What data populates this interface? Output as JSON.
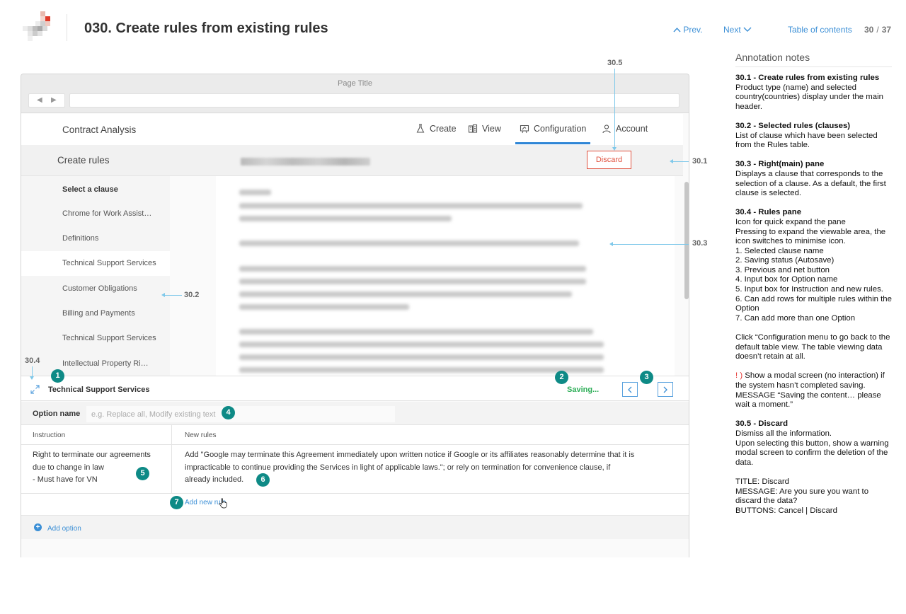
{
  "header": {
    "doc_title": "030. Create rules from existing rules",
    "prev_label": "Prev.",
    "next_label": "Next",
    "toc_label": "Table of contents",
    "page_current": "30",
    "page_sep": "/",
    "page_total": "37"
  },
  "mock": {
    "window_title": "Page Title",
    "app_name": "Contract Analysis",
    "menu": [
      {
        "label": "Create",
        "icon": "flask-icon"
      },
      {
        "label": "View",
        "icon": "building-icon"
      },
      {
        "label": "Configuration",
        "icon": "config-icon",
        "active": true
      },
      {
        "label": "Account",
        "icon": "user-icon"
      }
    ],
    "sub_title": "Create rules",
    "discard_label": "Discard",
    "sidebar": {
      "heading": "Select a clause",
      "items": [
        "Chrome for Work Assist…",
        "Definitions",
        "Technical Support Services",
        "Customer Obligations",
        "Billing and Payments",
        "Technical Support Services",
        "Intellectual Property Ri…"
      ],
      "selected_index": 2
    },
    "rules_pane": {
      "clause_name": "Technical Support Services",
      "saving_status": "Saving...",
      "option_label": "Option name",
      "option_placeholder": "e.g. Replace all, Modify existing text",
      "col_instruction": "Instruction",
      "col_new_rules": "New rules",
      "instruction_lines": [
        "Right to terminate our agreements",
        "due to change in law",
        "- Must have for VN"
      ],
      "new_rule_text": "Add \"Google may terminate this Agreement immediately upon written notice if Google or its affiliates reasonably determine that it is impracticable to continue providing the Services in light of applicable laws.\"; or rely on termination for convenience clause, if already included.",
      "add_new_rule": "Add new rule",
      "add_option": "Add option"
    }
  },
  "callouts": {
    "c30_1": "30.1",
    "c30_2": "30.2",
    "c30_3": "30.3",
    "c30_4": "30.4",
    "c30_5": "30.5",
    "badges": [
      "1",
      "2",
      "3",
      "4",
      "5",
      "6",
      "7"
    ]
  },
  "annotations": {
    "title": "Annotation notes",
    "s1_title": "30.1 - Create rules from existing rules",
    "s1_body": "Product type (name) and selected country(countries) display under the main header.",
    "s2_title": "30.2 - Selected rules (clauses)",
    "s2_body": "List of clause which have been selected from the Rules table.",
    "s3_title": "30.3 - Right(main) pane",
    "s3_body": "Displays a clause that corresponds to the selection of a clause. As a default, the first clause is selected.",
    "s4_title": "30.4 - Rules pane",
    "s4_body1": "Icon for quick expand the pane",
    "s4_body2": "Pressing to expand the viewable area, the icon switches to minimise icon.",
    "s4_list": [
      "1.    Selected clause name",
      "2.    Saving status (Autosave)",
      "3.    Previous and net button",
      "4.    Input box for Option name",
      "5.    Input box for Instruction and new rules.",
      "6.    Can add rows for multiple rules within the Option",
      "7.    Can add more than one Option"
    ],
    "s4_note": "Click “Configuration menu to go back to the default table view.  The table viewing data doesn’t retain at all.",
    "warn_mark": "! )",
    "warn_body": " Show a modal screen (no interaction) if the system hasn’t completed saving.",
    "warn_msg": "MESSAGE “Saving the content… please wait a moment.”",
    "s5_title": "30.5 - Discard",
    "s5_body1": "Dismiss all the information.",
    "s5_body2": "Upon selecting this button, show a warning modal screen to confirm the deletion of the data.",
    "s5_t": "TITLE: Discard",
    "s5_m": "MESSAGE: Are you sure you want to discard the data?",
    "s5_b": "BUTTONS:   Cancel    |     Discard"
  },
  "colors": {
    "accent_blue": "#2f86d6",
    "discard_red": "#e0523f",
    "saving_green": "#2eae58",
    "badge_teal": "#0e8a86",
    "callout_line": "#7ec8ea"
  }
}
